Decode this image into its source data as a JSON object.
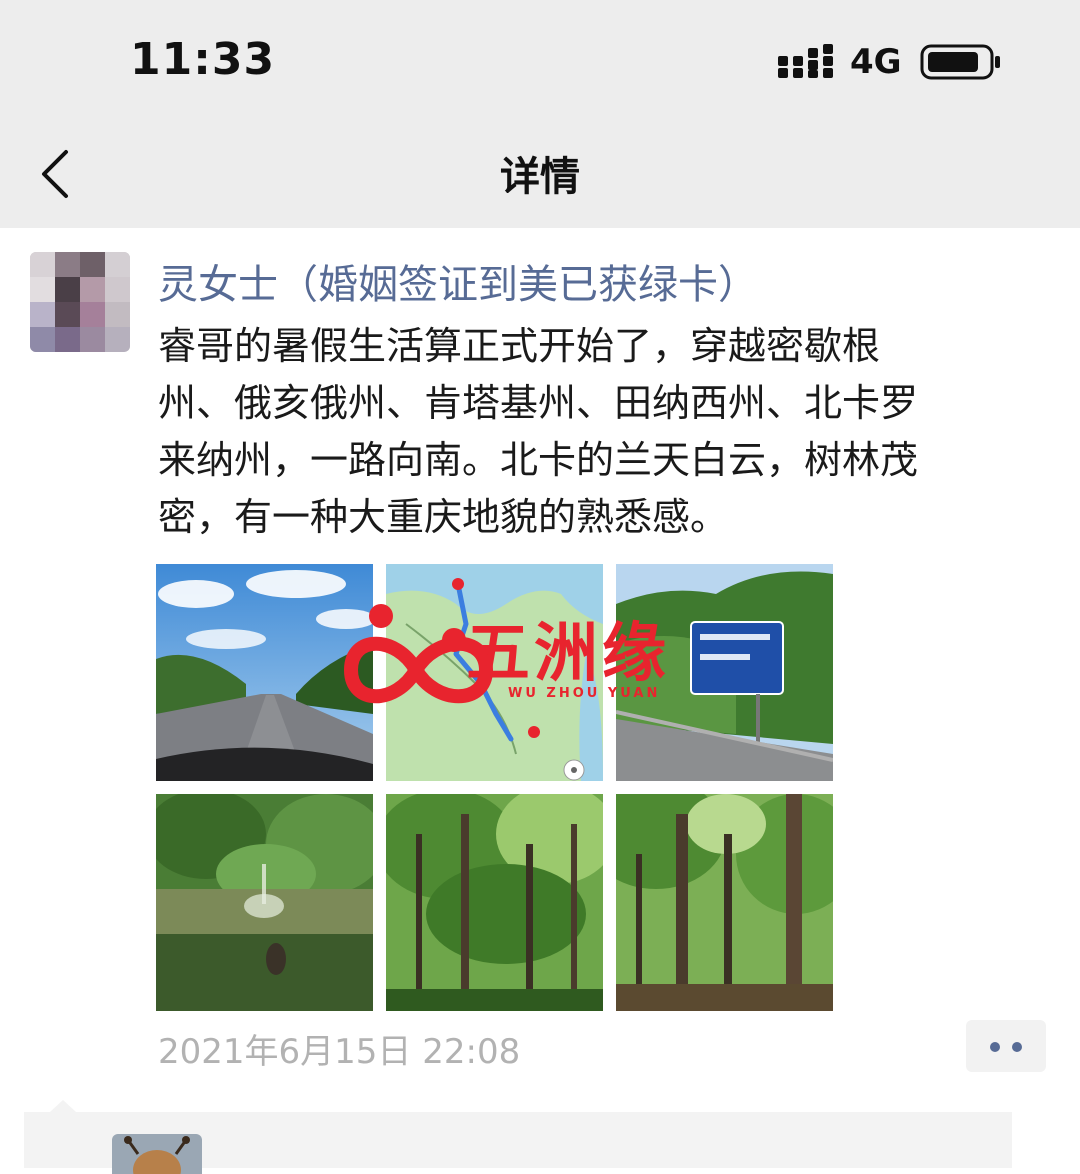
{
  "status_bar": {
    "time": "11:33",
    "network": "4G"
  },
  "nav": {
    "title": "详情",
    "back_icon": "chevron-left-icon"
  },
  "post": {
    "author": "灵女士（婚姻签证到美已获绿卡）",
    "text_lines": [
      "睿哥的暑假生活算正式开始了，穿越密歇根",
      "州、俄亥俄州、肯塔基州、田纳西州、北卡罗",
      "来纳州，一路向南。北卡的兰天白云，树林茂",
      "密，有一种大重庆地貌的熟悉感。"
    ],
    "timestamp": "2021年6月15日 22:08",
    "photos": [
      "highway-sky-photo",
      "route-map-photo",
      "road-sign-photo",
      "pond-fountain-photo",
      "forest-photo",
      "forest-trunks-photo"
    ]
  },
  "watermark": {
    "text": "五洲缘",
    "subtext": "WU ZHOU YUAN"
  },
  "colors": {
    "link": "#576b95",
    "background": "#ededed",
    "brand": "#e8242e"
  }
}
